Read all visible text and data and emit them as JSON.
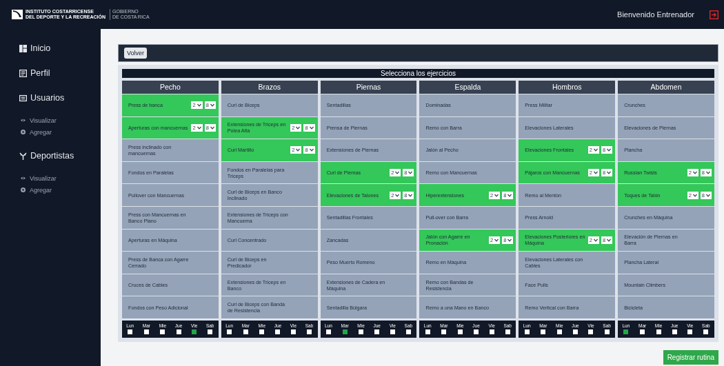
{
  "header": {
    "logo_lines": [
      "INSTITUTO COSTARRICENSE",
      "DEL DEPORTE Y LA RECREACIÓN"
    ],
    "gov_lines": [
      "GOBIERNO",
      "DE COSTA RICA"
    ],
    "welcome": "Bienvenido Entrenador"
  },
  "sidebar": {
    "items": [
      {
        "label": "Inicio"
      },
      {
        "label": "Perfil"
      },
      {
        "label": "Usuarios",
        "children": [
          {
            "label": "Visualizar"
          },
          {
            "label": "Agregar"
          }
        ]
      },
      {
        "label": "Deportistas",
        "children": [
          {
            "label": "Visualizar"
          },
          {
            "label": "Agregar"
          }
        ]
      }
    ]
  },
  "back_button": "Volver",
  "panel_title": "Selecciona los ejercicios",
  "columns": [
    {
      "name": "Pecho",
      "exercises": [
        {
          "name": "Press de banca",
          "selected": true,
          "sets": "2",
          "reps": "8"
        },
        {
          "name": "Aperturas con mancuernas",
          "selected": true,
          "sets": "2",
          "reps": "8"
        },
        {
          "name": "Press inclinado con mancuernas",
          "selected": false
        },
        {
          "name": "Fondos en Paralelas",
          "selected": false
        },
        {
          "name": "Pullover con Mancuernas",
          "selected": false
        },
        {
          "name": "Press con Mancuernas en Banco Plano",
          "selected": false
        },
        {
          "name": "Aperturas en Máquina",
          "selected": false
        },
        {
          "name": "Press de Banca con Agarre Cerrado",
          "selected": false
        },
        {
          "name": "Cruces de Cables",
          "selected": false
        },
        {
          "name": "Fondos con Peso Adicional",
          "selected": false
        }
      ],
      "days": [
        {
          "label": "Lun",
          "checked": false
        },
        {
          "label": "Mar",
          "checked": false
        },
        {
          "label": "Mie",
          "checked": false
        },
        {
          "label": "Jue",
          "checked": false
        },
        {
          "label": "Vie",
          "checked": true
        },
        {
          "label": "Sab",
          "checked": false
        }
      ]
    },
    {
      "name": "Brazos",
      "exercises": [
        {
          "name": "Curl de Biceps",
          "selected": false
        },
        {
          "name": "Extensiones de Triceps en Polea Alta",
          "selected": true,
          "sets": "2",
          "reps": "8"
        },
        {
          "name": "Curl Martillo",
          "selected": true,
          "sets": "2",
          "reps": "8"
        },
        {
          "name": "Fondos en Paralelas para Triceps",
          "selected": false
        },
        {
          "name": "Curl de Biceps en Banco Inclinado",
          "selected": false
        },
        {
          "name": "Extensiones de Triceps con Mancuerna",
          "selected": false
        },
        {
          "name": "Curl Concentrado",
          "selected": false
        },
        {
          "name": "Curl de Biceps en Predicador",
          "selected": false
        },
        {
          "name": "Extensiones de Triceps en Banco",
          "selected": false
        },
        {
          "name": "Curl de Biceps con Banda de Resistencia",
          "selected": false
        }
      ],
      "days": [
        {
          "label": "Lun",
          "checked": false
        },
        {
          "label": "Mar",
          "checked": false
        },
        {
          "label": "Mie",
          "checked": false
        },
        {
          "label": "Jue",
          "checked": false
        },
        {
          "label": "Vie",
          "checked": false
        },
        {
          "label": "Sab",
          "checked": false
        }
      ]
    },
    {
      "name": "Piernas",
      "exercises": [
        {
          "name": "Sentadillas",
          "selected": false
        },
        {
          "name": "Prensa de Piernas",
          "selected": false
        },
        {
          "name": "Extensiones de Piernas",
          "selected": false
        },
        {
          "name": "Curl de Piernas",
          "selected": true,
          "sets": "2",
          "reps": "8"
        },
        {
          "name": "Elevaciones de Talones",
          "selected": true,
          "sets": "2",
          "reps": "8"
        },
        {
          "name": "Sentadillas Frontales",
          "selected": false
        },
        {
          "name": "Zancadas",
          "selected": false
        },
        {
          "name": "Peso Muerto Romeno",
          "selected": false
        },
        {
          "name": "Extensiones de Cadera en Máquina",
          "selected": false
        },
        {
          "name": "Sentadilla Búlgara",
          "selected": false
        }
      ],
      "days": [
        {
          "label": "Lun",
          "checked": false
        },
        {
          "label": "Mar",
          "checked": true
        },
        {
          "label": "Mie",
          "checked": false
        },
        {
          "label": "Jue",
          "checked": false
        },
        {
          "label": "Vie",
          "checked": false
        },
        {
          "label": "Sab",
          "checked": false
        }
      ]
    },
    {
      "name": "Espalda",
      "exercises": [
        {
          "name": "Dominadas",
          "selected": false
        },
        {
          "name": "Remo con Barra",
          "selected": false
        },
        {
          "name": "Jalón al Pecho",
          "selected": false
        },
        {
          "name": "Remo con Mancuernas",
          "selected": false
        },
        {
          "name": "Hiperextensiones",
          "selected": true,
          "sets": "2",
          "reps": "8"
        },
        {
          "name": "Pull-over con Barra",
          "selected": false
        },
        {
          "name": "Jalón con Agarre en Pronación",
          "selected": true,
          "sets": "2",
          "reps": "8"
        },
        {
          "name": "Remo en Máquina",
          "selected": false
        },
        {
          "name": "Remo con Bandas de Resistencia",
          "selected": false
        },
        {
          "name": "Remo a una Mano en Banco",
          "selected": false
        }
      ],
      "days": [
        {
          "label": "Lun",
          "checked": false
        },
        {
          "label": "Mar",
          "checked": false
        },
        {
          "label": "Mie",
          "checked": false
        },
        {
          "label": "Jue",
          "checked": false
        },
        {
          "label": "Vie",
          "checked": false
        },
        {
          "label": "Sab",
          "checked": false
        }
      ]
    },
    {
      "name": "Hombros",
      "exercises": [
        {
          "name": "Press Militar",
          "selected": false
        },
        {
          "name": "Elevaciones Laterales",
          "selected": false
        },
        {
          "name": "Elevaciones Frontales",
          "selected": true,
          "sets": "2",
          "reps": "8"
        },
        {
          "name": "Pájaros con Mancuernas",
          "selected": true,
          "sets": "2",
          "reps": "8"
        },
        {
          "name": "Remo al Mentón",
          "selected": false
        },
        {
          "name": "Press Arnold",
          "selected": false
        },
        {
          "name": "Elevaciones Posteriores en Máquina",
          "selected": true,
          "sets": "2",
          "reps": "8"
        },
        {
          "name": "Elevaciones Laterales con Cables",
          "selected": false
        },
        {
          "name": "Face Pulls",
          "selected": false
        },
        {
          "name": "Remo Vertical con Barra",
          "selected": false
        }
      ],
      "days": [
        {
          "label": "Lun",
          "checked": false
        },
        {
          "label": "Mar",
          "checked": false
        },
        {
          "label": "Mie",
          "checked": false
        },
        {
          "label": "Jue",
          "checked": false
        },
        {
          "label": "Vie",
          "checked": false
        },
        {
          "label": "Sab",
          "checked": false
        }
      ]
    },
    {
      "name": "Abdomen",
      "exercises": [
        {
          "name": "Crunches",
          "selected": false
        },
        {
          "name": "Elevaciones de Piernas",
          "selected": false
        },
        {
          "name": "Plancha",
          "selected": false
        },
        {
          "name": "Russian Twists",
          "selected": true,
          "sets": "2",
          "reps": "8"
        },
        {
          "name": "Toques de Talón",
          "selected": true,
          "sets": "2",
          "reps": "8"
        },
        {
          "name": "Crunches en Máquina",
          "selected": false
        },
        {
          "name": "Elevación de Piernas en Barra",
          "selected": false
        },
        {
          "name": "Plancha Lateral",
          "selected": false
        },
        {
          "name": "Mountain Climbers",
          "selected": false
        },
        {
          "name": "Bicicleta",
          "selected": false
        }
      ],
      "days": [
        {
          "label": "Lun",
          "checked": true
        },
        {
          "label": "Mar",
          "checked": false
        },
        {
          "label": "Mie",
          "checked": false
        },
        {
          "label": "Jue",
          "checked": false
        },
        {
          "label": "Vie",
          "checked": false
        },
        {
          "label": "Sab",
          "checked": false
        }
      ]
    }
  ],
  "submit_button": "Registrar rutina"
}
